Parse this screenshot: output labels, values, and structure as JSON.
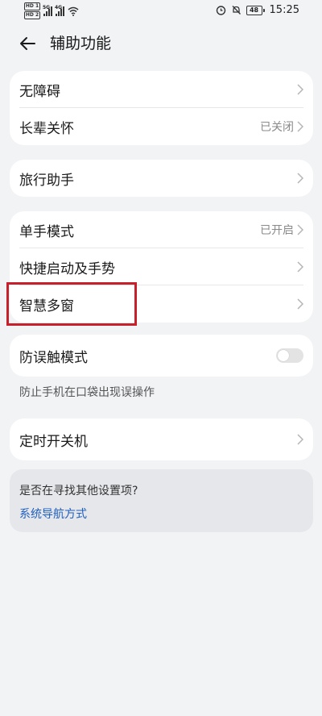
{
  "statusbar": {
    "sim1": "HD 1",
    "sim2": "HD 2",
    "net1": "5G",
    "net2": "4G",
    "battery": "48",
    "time": "15:25"
  },
  "header": {
    "title": "辅助功能"
  },
  "cards": {
    "c1": [
      {
        "label": "无障碍",
        "value": ""
      },
      {
        "label": "长辈关怀",
        "value": "已关闭"
      }
    ],
    "c2": [
      {
        "label": "旅行助手",
        "value": ""
      }
    ],
    "c3": [
      {
        "label": "单手模式",
        "value": "已开启"
      },
      {
        "label": "快捷启动及手势",
        "value": ""
      },
      {
        "label": "智慧多窗",
        "value": ""
      }
    ],
    "c4": {
      "label": "防误触模式",
      "toggle_on": false,
      "hint": "防止手机在口袋出现误操作"
    },
    "c5": [
      {
        "label": "定时开关机",
        "value": ""
      }
    ]
  },
  "search": {
    "question": "是否在寻找其他设置项?",
    "link": "系统导航方式"
  },
  "colors": {
    "page_bg": "#f1f3f5",
    "card_bg": "#ffffff",
    "link": "#1f5fbf",
    "highlight_border": "#c8202a"
  }
}
